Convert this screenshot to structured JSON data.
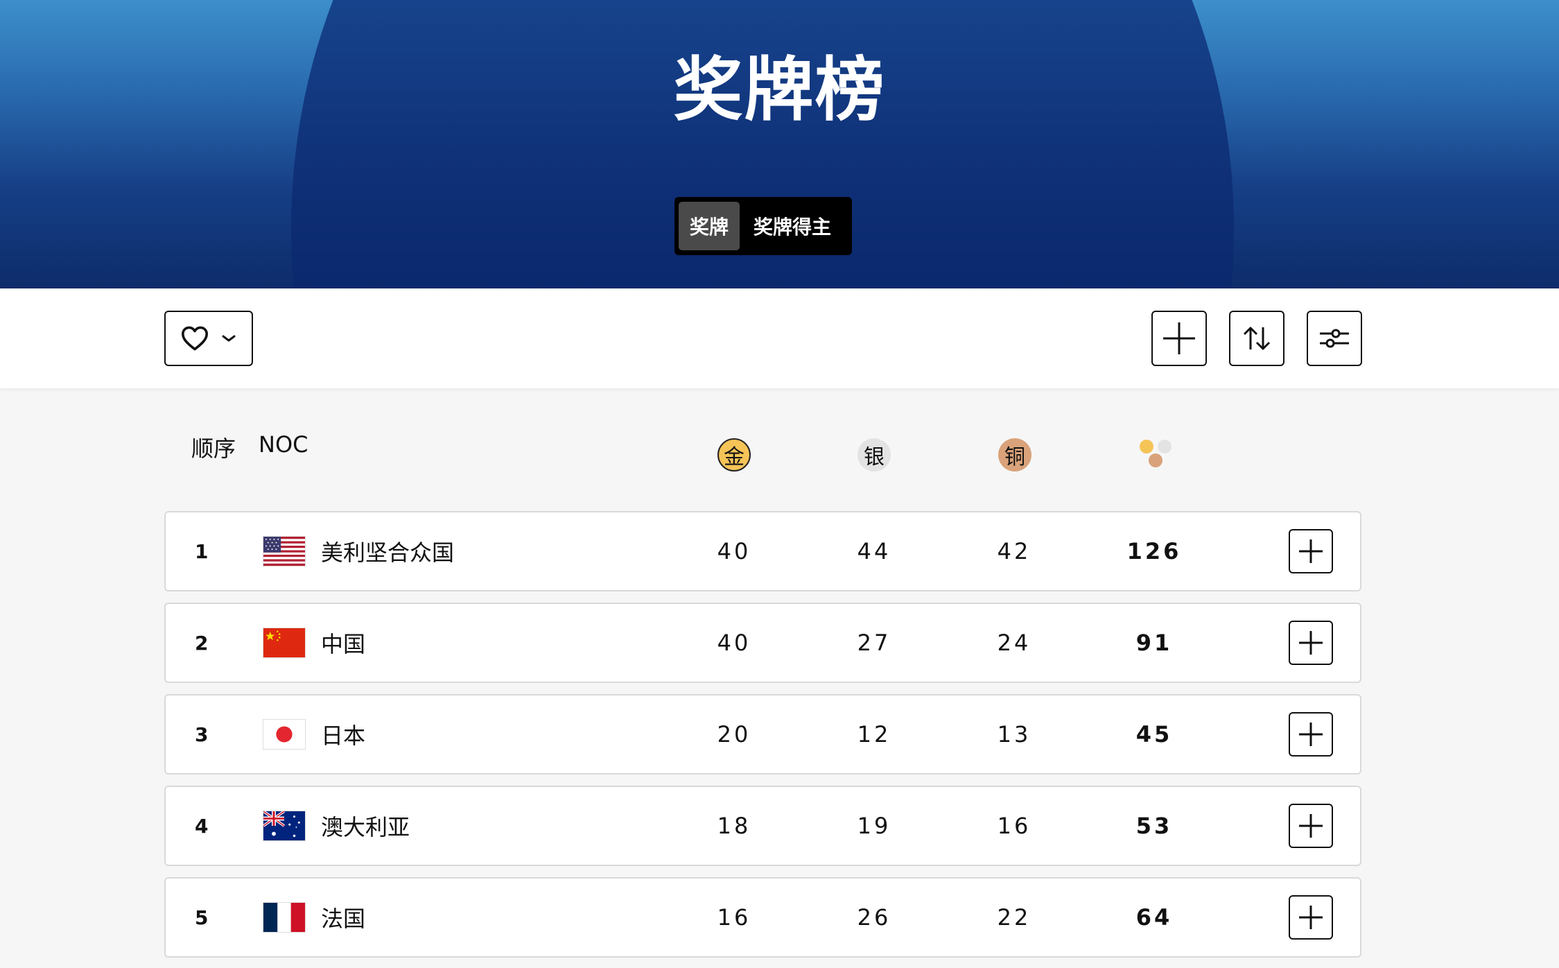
{
  "hero": {
    "title": "奖牌榜",
    "tabs": [
      {
        "label": "奖牌",
        "active": true
      },
      {
        "label": "奖牌得主",
        "active": false
      }
    ]
  },
  "toolbar": {
    "favorite_icon": "heart-icon",
    "dropdown_icon": "chevron-down-icon",
    "add_icon": "plus-icon",
    "sort_icon": "sort-arrows-icon",
    "filter_icon": "sliders-icon"
  },
  "table": {
    "headers": {
      "rank": "顺序",
      "noc": "NOC",
      "gold": "金",
      "silver": "银",
      "bronze": "铜"
    },
    "colors": {
      "gold": "#f5c457",
      "silver": "#e3e3e3",
      "bronze": "#d9a27a"
    },
    "rows": [
      {
        "rank": "1",
        "country": "美利坚合众国",
        "flag": "usa",
        "gold": "40",
        "silver": "44",
        "bronze": "42",
        "total": "126"
      },
      {
        "rank": "2",
        "country": "中国",
        "flag": "china",
        "gold": "40",
        "silver": "27",
        "bronze": "24",
        "total": "91"
      },
      {
        "rank": "3",
        "country": "日本",
        "flag": "japan",
        "gold": "20",
        "silver": "12",
        "bronze": "13",
        "total": "45"
      },
      {
        "rank": "4",
        "country": "澳大利亚",
        "flag": "australia",
        "gold": "18",
        "silver": "19",
        "bronze": "16",
        "total": "53"
      },
      {
        "rank": "5",
        "country": "法国",
        "flag": "france",
        "gold": "16",
        "silver": "26",
        "bronze": "22",
        "total": "64"
      }
    ]
  }
}
